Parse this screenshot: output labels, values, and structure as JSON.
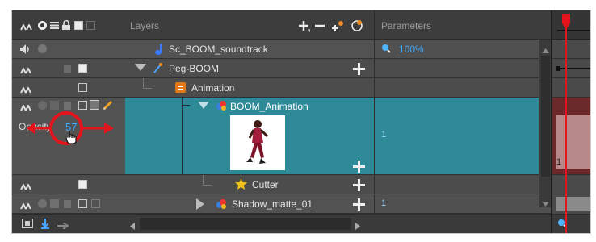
{
  "header": {
    "layers_title": "Layers",
    "parameters_title": "Parameters"
  },
  "layers": [
    {
      "name": "Sc_BOOM_soundtrack",
      "type": "sound",
      "param": "100%"
    },
    {
      "name": "Peg-BOOM",
      "type": "peg",
      "param": ""
    },
    {
      "name": "Animation",
      "type": "group",
      "param": ""
    },
    {
      "name": "BOOM_Animation",
      "type": "drawing",
      "param": "1",
      "selected": true
    },
    {
      "name": "Cutter",
      "type": "cutter",
      "param": ""
    },
    {
      "name": "Shadow_matte_01",
      "type": "drawing",
      "param": "1"
    }
  ],
  "opacity": {
    "label": "Opacity",
    "value": "57"
  },
  "timeline": {
    "frame_number": "1"
  },
  "colors": {
    "panel_bg": "#444444",
    "row_bg": "#505050",
    "selected_bg": "#2f8a98",
    "accent_blue": "#3fa8ff",
    "highlight_red": "#e3141b"
  },
  "icons": {
    "header": [
      "animate-icon",
      "visibility-icon",
      "stack-icon",
      "lock-icon",
      "color-swatch-icon",
      "thumbnail-icon"
    ],
    "toolbar": [
      "add-layer-icon",
      "remove-layer-icon",
      "add-drawing-layer-icon",
      "add-peg-icon"
    ],
    "footer": [
      "layer-view-icon",
      "shortcut-icon",
      "arrow-right-icon"
    ]
  }
}
